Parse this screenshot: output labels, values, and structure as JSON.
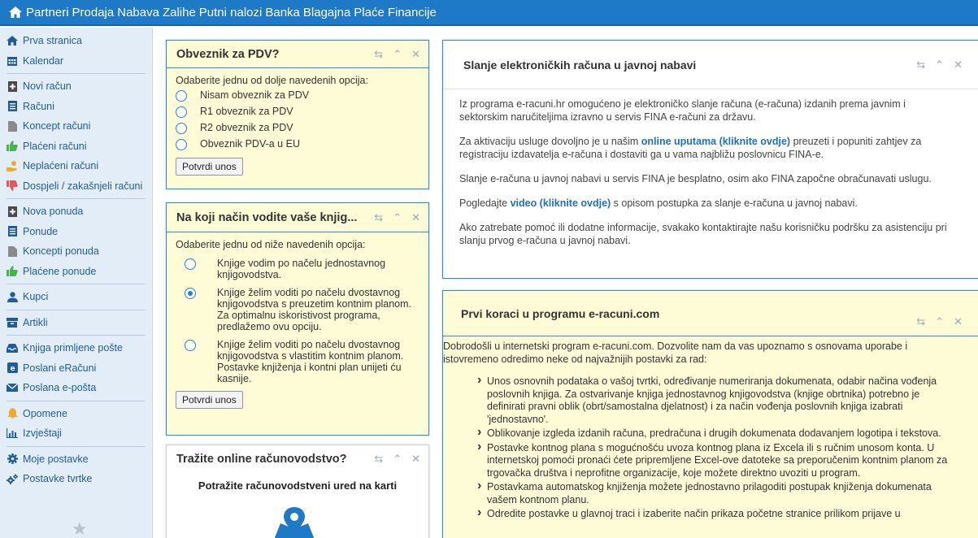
{
  "topnav": {
    "items": [
      "Partneri",
      "Prodaja",
      "Nabava",
      "Zalihe",
      "Putni nalozi",
      "Banka",
      "Blagajna",
      "Plaće",
      "Financije"
    ]
  },
  "sidebar": {
    "items": [
      {
        "label": "Prva stranica",
        "icon": "home-icon",
        "color": "#1f5c99"
      },
      {
        "label": "Kalendar",
        "icon": "calendar-icon",
        "color": "#1f5c99"
      },
      {
        "label": "Novi račun",
        "icon": "new-document-icon",
        "color": "#4a4a4a"
      },
      {
        "label": "Računi",
        "icon": "documents-icon",
        "color": "#1f5c99"
      },
      {
        "label": "Koncept računi",
        "icon": "draft-document-icon",
        "color": "#888888"
      },
      {
        "label": "Plaćeni računi",
        "icon": "thumbs-up-icon",
        "color": "#4caf50"
      },
      {
        "label": "Neplaćeni računi",
        "icon": "hand-coin-icon",
        "color": "#f0a830"
      },
      {
        "label": "Dospjeli / zakašnjeli računi",
        "icon": "thumbs-down-icon",
        "color": "#e05a5a"
      },
      {
        "label": "Nova ponuda",
        "icon": "new-document-icon",
        "color": "#4a4a4a"
      },
      {
        "label": "Ponude",
        "icon": "documents-icon",
        "color": "#1f5c99"
      },
      {
        "label": "Koncepti ponuda",
        "icon": "draft-document-icon",
        "color": "#888888"
      },
      {
        "label": "Plaćene ponude",
        "icon": "thumbs-up-icon",
        "color": "#4caf50"
      },
      {
        "label": "Kupci",
        "icon": "user-icon",
        "color": "#1f5c99"
      },
      {
        "label": "Artikli",
        "icon": "box-icon",
        "color": "#1f5c99"
      },
      {
        "label": "Knjiga primljene pošte",
        "icon": "inbox-icon",
        "color": "#1f5c99"
      },
      {
        "label": "Poslani eRačuni",
        "icon": "e-invoice-icon",
        "color": "#1f5c99"
      },
      {
        "label": "Poslana e-pošta",
        "icon": "envelope-icon",
        "color": "#1f5c99"
      },
      {
        "label": "Opomene",
        "icon": "bell-icon",
        "color": "#f0a830"
      },
      {
        "label": "Izvještaji",
        "icon": "chart-icon",
        "color": "#1f5c99"
      },
      {
        "label": "Moje postavke",
        "icon": "gear-icon",
        "color": "#1f5c99"
      },
      {
        "label": "Postavke tvrtke",
        "icon": "gears-icon",
        "color": "#1f5c99"
      }
    ]
  },
  "pdv_panel": {
    "title": "Obveznik za PDV?",
    "prompt": "Odaberite jednu od dolje navedenih opcija:",
    "options": [
      "Nisam obveznik za PDV",
      "R1 obveznik za PDV",
      "R2 obveznik za PDV",
      "Obveznik PDV-a u EU"
    ],
    "button": "Potvrdi unos"
  },
  "books_panel": {
    "title": "Na koji način vodite vaše knjig...",
    "prompt": "Odaberite jednu od niže navedenih opcija:",
    "options": [
      "Knjige vodim po načelu jednostavnog knjigovodstva.",
      "Knjige želim voditi po načelu dvostavnog knjigovodstva s preuzetim kontnim planom. Za optimalnu iskoristivost programa, predlažemo ovu opciju.",
      "Knjige želim voditi po načelu dvostavnog knjigovodstva s vlastitim kontnim planom. Postavke knjiženja i kontni plan unijeti ću kasnije."
    ],
    "selected": 1,
    "button": "Potvrdi unos"
  },
  "online_panel": {
    "title": "Tražite online računovodstvo?",
    "subtitle": "Potražite računovodstveni ured na karti"
  },
  "einvoice_panel": {
    "title": "Slanje elektroničkih računa u javnoj nabavi",
    "p1": "Iz programa e-racuni.hr omogućeno je elektroničko slanje računa (e-računa) izdanih prema javnim i sektorskim naručiteljima izravno u servis FINA e-računi za državu.",
    "p2_before": "Za aktivaciju usluge dovoljno je u našim ",
    "p2_link": "online uputama (kliknite ovdje)",
    "p2_after": " preuzeti i popuniti zahtjev za registraciju izdavatelja e-računa i dostaviti ga u vama najbližu poslovnicu FINA-e.",
    "p3": "Slanje e-računa u javnoj nabavi u servis FINA je besplatno, osim ako FINA započne obračunavati uslugu.",
    "p4_before": "Pogledajte ",
    "p4_link": "video (kliknite ovdje)",
    "p4_after": " s opisom postupka za slanje e-računa u javnoj nabavi.",
    "p5": "Ako zatrebate pomoć ili dodatne informacije, svakako kontaktirajte našu korisničku podršku za asistenciju pri slanju prvog e-računa u javnoj nabavi."
  },
  "firststeps_panel": {
    "title": "Prvi koraci u programu e-racuni.com",
    "intro": "Dobrodošli u internetski program e-racuni.com. Dozvolite nam da vas upoznamo s osnovama uporabe i istovremeno odredimo neke od najvažnijih postavki za rad:",
    "bullets": [
      "Unos osnovnih podataka o vašoj tvrtki, određivanje numeriranja dokumenata, odabir načina vođenja poslovnih knjiga. Za ostvarivanje knjiga jednostavnog knjigovodstva (knjige obrtnika) potrebno je definirati pravni oblik (obrt/samostalna djelatnost) i za način vođenja poslovnih knjiga izabrati 'jednostavno'.",
      "Oblikovanje izgleda izdanih računa, predračuna i drugih dokumenata dodavanjem logotipa i tekstova.",
      "Postavke kontnog plana s mogućnošću uvoza kontnog plana iz Excela ili s ručnim unosom konta. U internetskoj pomoći pronaći ćete pripremljene Excel-ove datoteke sa preporučenim kontnim planom za trgovačka društva i neprofitne organizacije,  koje možete direktno uvoziti u program.",
      "Postavkama automatskog knjiženja možete jednostavno prilagoditi postupak knjiženja dokumenata vašem kontnom planu.",
      "Odredite postavke u glavnoj traci i izaberite način prikaza početne stranice prilikom prijave u"
    ]
  },
  "colors": {
    "accent": "#1e7ac6",
    "panel_border": "#2c8ad6",
    "yellow_panel": "#fefcd7",
    "sidebar_bg": "#e3edf7",
    "link": "#1e6fc0"
  }
}
